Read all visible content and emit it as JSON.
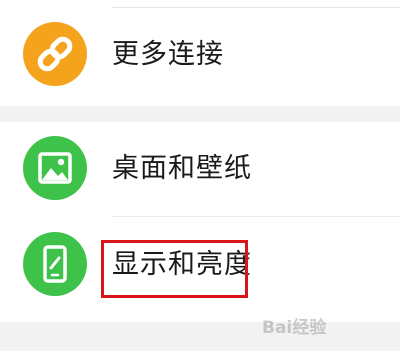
{
  "settings": {
    "items": [
      {
        "label": "更多连接",
        "icon": "link-icon",
        "color": "#f5a31c"
      },
      {
        "label": "桌面和壁纸",
        "icon": "image-icon",
        "color": "#3fc24a"
      },
      {
        "label": "显示和亮度",
        "icon": "phone-brightness-icon",
        "color": "#3fc24a"
      }
    ]
  },
  "annotation": {
    "highlight_color": "#d9141b"
  },
  "watermark": {
    "text": "Bai经验"
  }
}
